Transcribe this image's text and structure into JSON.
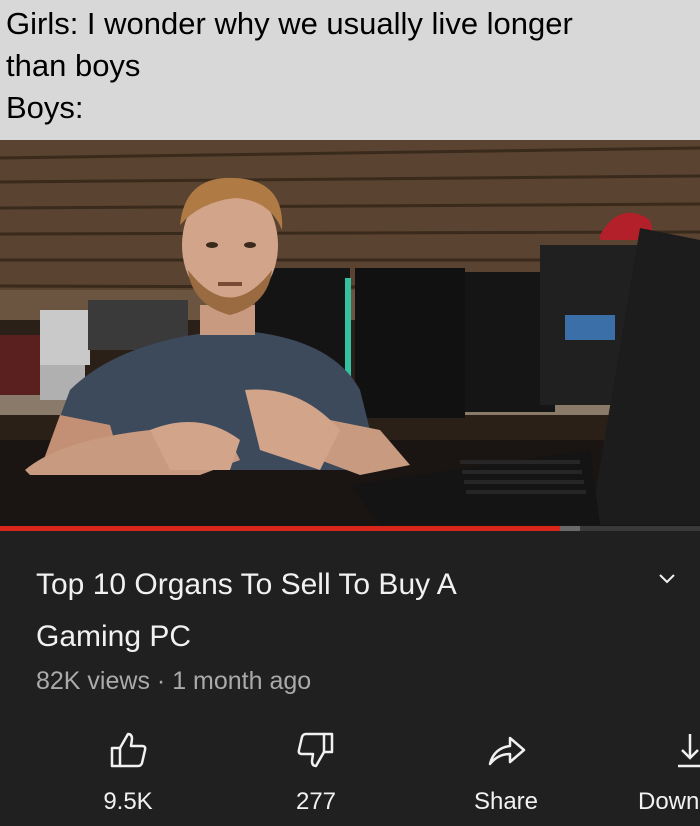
{
  "caption": {
    "lines": [
      "Girls: I wonder why we usually live longer",
      "than boys",
      "Boys:"
    ]
  },
  "video": {
    "title": "Top 10 Organs To Sell To Buy A Gaming PC",
    "title_lines": [
      "Top 10 Organs To Sell To Buy A",
      "Gaming PC"
    ],
    "views": "82K views",
    "separator": "·",
    "age": "1 month ago",
    "progress": 0.8
  },
  "actions": {
    "like_count": "9.5K",
    "dislike_count": "277",
    "share_label": "Share",
    "download_label": "Down"
  },
  "colors": {
    "caption_bg": "#d8d8d8",
    "panel_bg": "#202020",
    "progress_red": "#d8261b",
    "text_primary": "#f1f1f1",
    "text_secondary": "#aaaaaa"
  },
  "icons": {
    "like": "thumbs-up-icon",
    "dislike": "thumbs-down-icon",
    "share": "share-arrow-icon",
    "download": "download-icon",
    "expand": "chevron-down-icon"
  }
}
